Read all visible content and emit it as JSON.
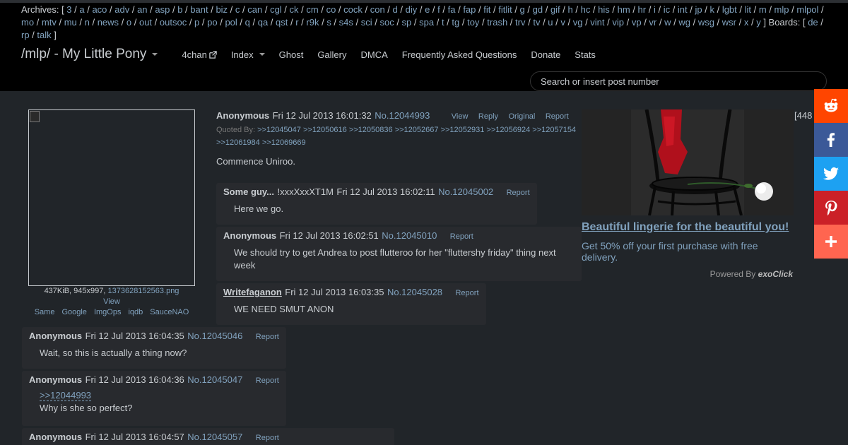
{
  "archives_label": "Archives: [",
  "archives": [
    "3",
    "a",
    "aco",
    "adv",
    "an",
    "asp",
    "b",
    "bant",
    "biz",
    "c",
    "can",
    "cgl",
    "ck",
    "cm",
    "co",
    "cock",
    "con",
    "d",
    "diy",
    "e",
    "f",
    "fa",
    "fap",
    "fit",
    "fitlit",
    "g",
    "gd",
    "gif",
    "h",
    "hc",
    "his",
    "hm",
    "hr",
    "i",
    "ic",
    "int",
    "jp",
    "k",
    "lgbt",
    "lit",
    "m",
    "mlp",
    "mlpol",
    "mo",
    "mtv",
    "mu",
    "n",
    "news",
    "o",
    "out",
    "outsoc",
    "p",
    "po",
    "pol",
    "q",
    "qa",
    "qst",
    "r",
    "r9k",
    "s",
    "s4s",
    "sci",
    "soc",
    "sp",
    "spa",
    "t",
    "tg",
    "toy",
    "trash",
    "trv",
    "tv",
    "u",
    "v",
    "vg",
    "vint",
    "vip",
    "vp",
    "vr",
    "w",
    "wg",
    "wsg",
    "wsr",
    "x",
    "y"
  ],
  "archives_close": "]",
  "boards_label": "Boards: [",
  "boards": [
    "de",
    "rp",
    "talk"
  ],
  "boards_close": "]",
  "board_title": "/mlp/ - My Little Pony",
  "nav": [
    "4chan",
    "Index",
    "Ghost",
    "Gallery",
    "DMCA",
    "Frequently Asked Questions",
    "Donate",
    "Stats"
  ],
  "search_placeholder": "Search or insert post number",
  "op": {
    "file_meta": "437KiB, 945x997,",
    "filename": "1373628152563.png",
    "view": "View",
    "tools": [
      "Same",
      "Google",
      "ImgOps",
      "iqdb",
      "SauceNAO"
    ],
    "name": "Anonymous",
    "date": "Fri 12 Jul 2013 16:01:32",
    "no": "No.12044993",
    "controls": [
      "View",
      "Reply",
      "Original",
      "Report"
    ],
    "quoted_label": "Quoted By:",
    "quoted_by": [
      ">>12045047",
      ">>12050616",
      ">>12050836",
      ">>12052667",
      ">>12052931",
      ">>12056924",
      ">>12057154",
      ">>12061984",
      ">>12069669"
    ],
    "message": "Commence Uniroo."
  },
  "replies": [
    {
      "name": "Some guy...",
      "trip": "!xxxXxxXT1M",
      "date": "Fri 12 Jul 2013 16:02:11",
      "no": "No.12045002",
      "report": "Report",
      "message": "Here we go."
    },
    {
      "name": "Anonymous",
      "date": "Fri 12 Jul 2013 16:02:51",
      "no": "No.12045010",
      "report": "Report",
      "message": "We should try to get Andrea to post flutteroo for her \"fluttershy friday\" thing next week"
    },
    {
      "name": "Writefaganon",
      "date": "Fri 12 Jul 2013 16:03:35",
      "no": "No.12045028",
      "report": "Report",
      "message": "WE NEED SMUT ANON"
    },
    {
      "name": "Anonymous",
      "date": "Fri 12 Jul 2013 16:04:35",
      "no": "No.12045046",
      "report": "Report",
      "message": "Wait, so this is actually a thing now?"
    },
    {
      "name": "Anonymous",
      "date": "Fri 12 Jul 2013 16:04:36",
      "no": "No.12045047",
      "report": "Report",
      "quote": ">>12044993",
      "message": "Why is she so perfect?"
    },
    {
      "name": "Anonymous",
      "date": "Fri 12 Jul 2013 16:04:57",
      "no": "No.12045057",
      "report": "Report"
    }
  ],
  "ad": {
    "headline": "Beautiful lingerie for the beautiful you!",
    "body": "Get 50% off your first purchase with free delivery.",
    "powered_by": "Powered By",
    "brand": "exoClick",
    "count": "[448"
  },
  "share": [
    {
      "name": "reddit",
      "color": "#ff4500",
      "icon": "reddit-icon"
    },
    {
      "name": "facebook",
      "color": "#3b5998",
      "icon": "facebook-icon"
    },
    {
      "name": "twitter",
      "color": "#1da1f2",
      "icon": "twitter-icon"
    },
    {
      "name": "pinterest",
      "color": "#cb2027",
      "icon": "pinterest-icon"
    },
    {
      "name": "more",
      "color": "#ff6550",
      "icon": "plus-icon"
    }
  ]
}
